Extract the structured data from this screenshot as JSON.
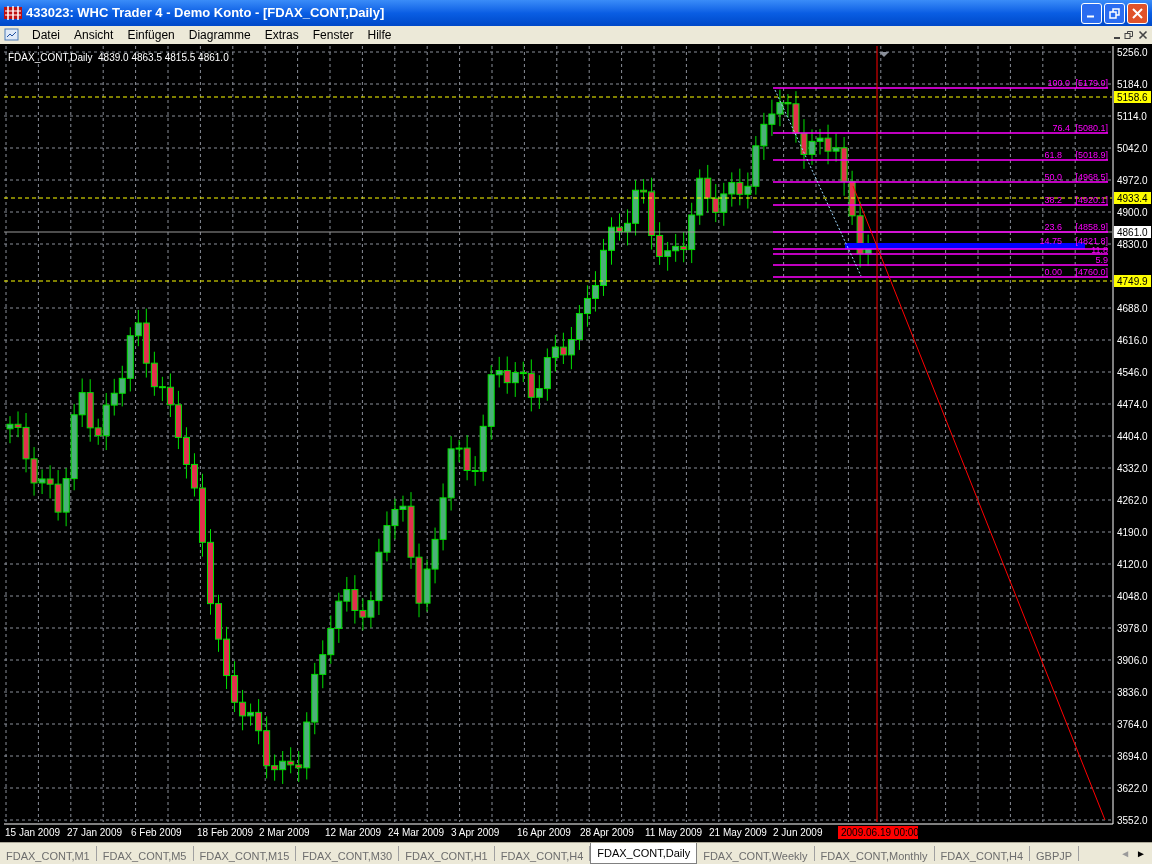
{
  "window": {
    "title": "433023: WHC Trader 4 - Demo Konto - [FDAX_CONT,Daily]"
  },
  "menu": [
    "Datei",
    "Ansicht",
    "Einfügen",
    "Diagramme",
    "Extras",
    "Fenster",
    "Hilfe"
  ],
  "chart": {
    "info": "FDAX_CONT,Daily  4839.0 4863.5 4815.5 4861.0",
    "price_axis": [
      "5256.0",
      "5184.0",
      "5114.0",
      "5042.0",
      "4972.0",
      "4900.0",
      "4830.0",
      "4688.0",
      "4616.0",
      "4546.0",
      "4474.0",
      "4404.0",
      "4332.0",
      "4262.0",
      "4190.0",
      "4120.0",
      "4048.0",
      "3978.0",
      "3906.0",
      "3836.0",
      "3764.0",
      "3694.0",
      "3622.0",
      "3552.0"
    ],
    "fib_levels": [
      {
        "level": "100.0",
        "price": "[5179.0]"
      },
      {
        "level": "76.4",
        "price": "[5080.1]"
      },
      {
        "level": "61.8",
        "price": "[5018.9]"
      },
      {
        "level": "50.0",
        "price": "[4968.5]"
      },
      {
        "level": "38.2",
        "price": "[4920.1]"
      },
      {
        "level": "23.6",
        "price": "[4858.9]"
      },
      {
        "level": "14.75",
        "price": "[4821.8]"
      },
      {
        "level": "11.8"
      },
      {
        "level": "5.9"
      },
      {
        "level": "0.00",
        "price": "[4760.0]"
      }
    ],
    "price_tags": [
      {
        "text": "5158.6",
        "kind": "level"
      },
      {
        "text": "4933.4",
        "kind": "level"
      },
      {
        "text": "4861.0",
        "kind": "bid"
      },
      {
        "text": "4749.9",
        "kind": "level"
      }
    ],
    "dates": [
      "15 Jan 2009",
      "27 Jan 2009",
      "6 Feb 2009",
      "18 Feb 2009",
      "2 Mar 2009",
      "12 Mar 2009",
      "24 Mar 2009",
      "3 Apr 2009",
      "16 Apr 2009",
      "28 Apr 2009",
      "11 May 2009",
      "21 May 2009",
      "2 Jun 2009"
    ],
    "cursor_date": "2009.06.19 00:00"
  },
  "tabs": [
    {
      "label": "FDAX_CONT,M1",
      "selected": false
    },
    {
      "label": "FDAX_CONT,M5",
      "selected": false
    },
    {
      "label": "FDAX_CONT,M15",
      "selected": false
    },
    {
      "label": "FDAX_CONT,M30",
      "selected": false
    },
    {
      "label": "FDAX_CONT,H1",
      "selected": false
    },
    {
      "label": "FDAX_CONT,H4",
      "selected": false
    },
    {
      "label": "FDAX_CONT,Daily",
      "selected": true
    },
    {
      "label": "FDAX_CONT,Weekly",
      "selected": false
    },
    {
      "label": "FDAX_CONT,Monthly",
      "selected": false
    },
    {
      "label": "FDAX_CONT,H4",
      "selected": false
    },
    {
      "label": "GBPJP",
      "selected": false
    }
  ],
  "tab_scroll": [
    "◄",
    "►"
  ]
}
